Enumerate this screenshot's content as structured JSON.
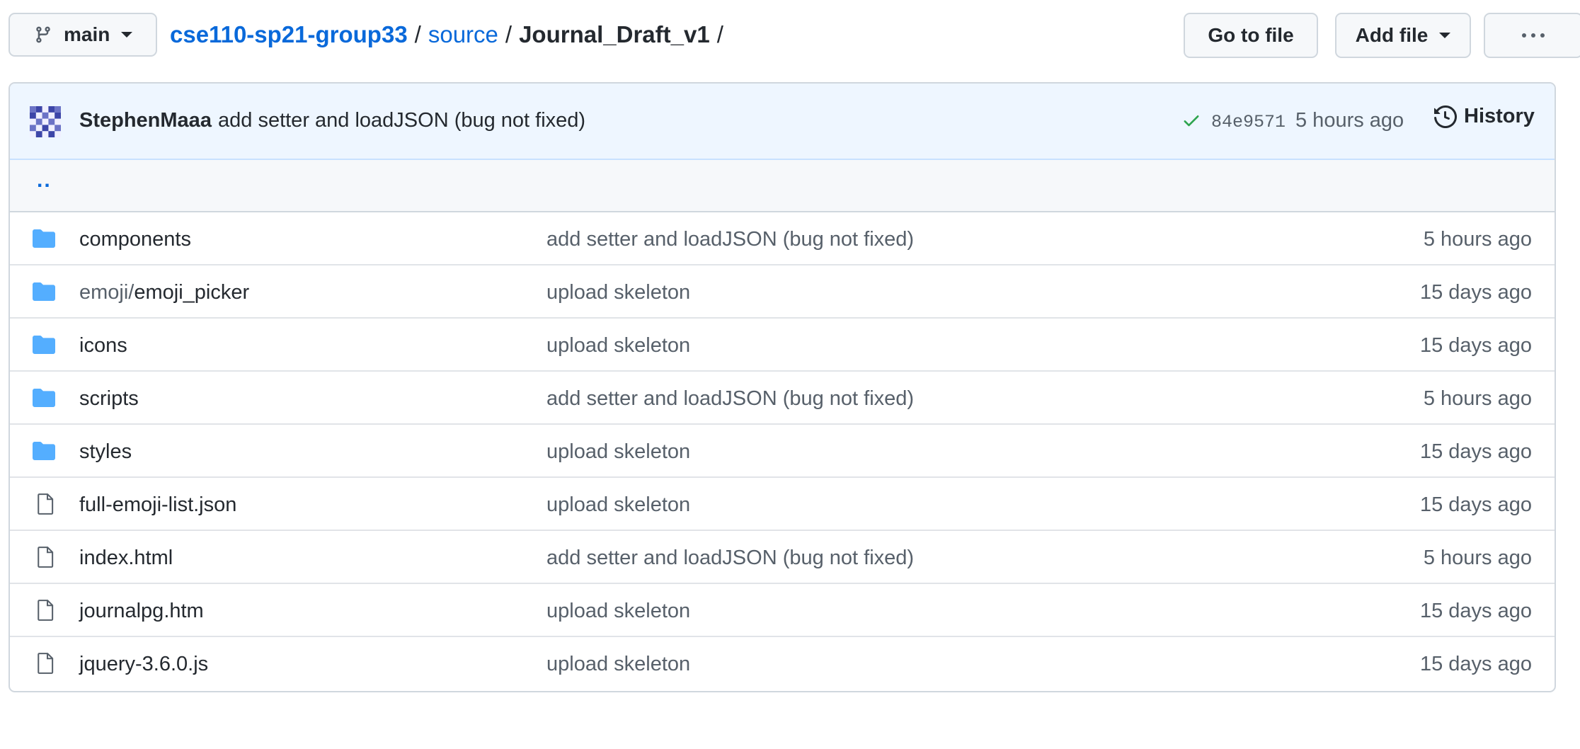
{
  "branch": {
    "name": "main"
  },
  "breadcrumb": {
    "repo": "cse110-sp21-group33",
    "sep1": "/",
    "folder": "source",
    "sep2": "/",
    "current": "Journal_Draft_v1",
    "sep3": "/"
  },
  "toolbar": {
    "goto_label": "Go to file",
    "add_label": "Add file",
    "more_icon": "kebab-horizontal-icon"
  },
  "commit": {
    "author": "StephenMaaa",
    "message": "add setter and loadJSON (bug not fixed)",
    "sha": "84e9571",
    "time": "5 hours ago",
    "history_label": "History",
    "status_color": "#2da44e"
  },
  "parent_link": "..",
  "files": [
    {
      "type": "folder",
      "prefix": "",
      "name": "components",
      "message": "add setter and loadJSON (bug not fixed)",
      "age": "5 hours ago"
    },
    {
      "type": "folder",
      "prefix": "emoji/",
      "name": "emoji_picker",
      "message": "upload skeleton",
      "age": "15 days ago"
    },
    {
      "type": "folder",
      "prefix": "",
      "name": "icons",
      "message": "upload skeleton",
      "age": "15 days ago"
    },
    {
      "type": "folder",
      "prefix": "",
      "name": "scripts",
      "message": "add setter and loadJSON (bug not fixed)",
      "age": "5 hours ago"
    },
    {
      "type": "folder",
      "prefix": "",
      "name": "styles",
      "message": "upload skeleton",
      "age": "15 days ago"
    },
    {
      "type": "file",
      "prefix": "",
      "name": "full-emoji-list.json",
      "message": "upload skeleton",
      "age": "15 days ago"
    },
    {
      "type": "file",
      "prefix": "",
      "name": "index.html",
      "message": "add setter and loadJSON (bug not fixed)",
      "age": "5 hours ago"
    },
    {
      "type": "file",
      "prefix": "",
      "name": "journalpg.htm",
      "message": "upload skeleton",
      "age": "15 days ago"
    },
    {
      "type": "file",
      "prefix": "",
      "name": "jquery-3.6.0.js",
      "message": "upload skeleton",
      "age": "15 days ago"
    }
  ],
  "colors": {
    "link": "#0969da",
    "folder": "#54aeff",
    "muted": "#57606a"
  }
}
